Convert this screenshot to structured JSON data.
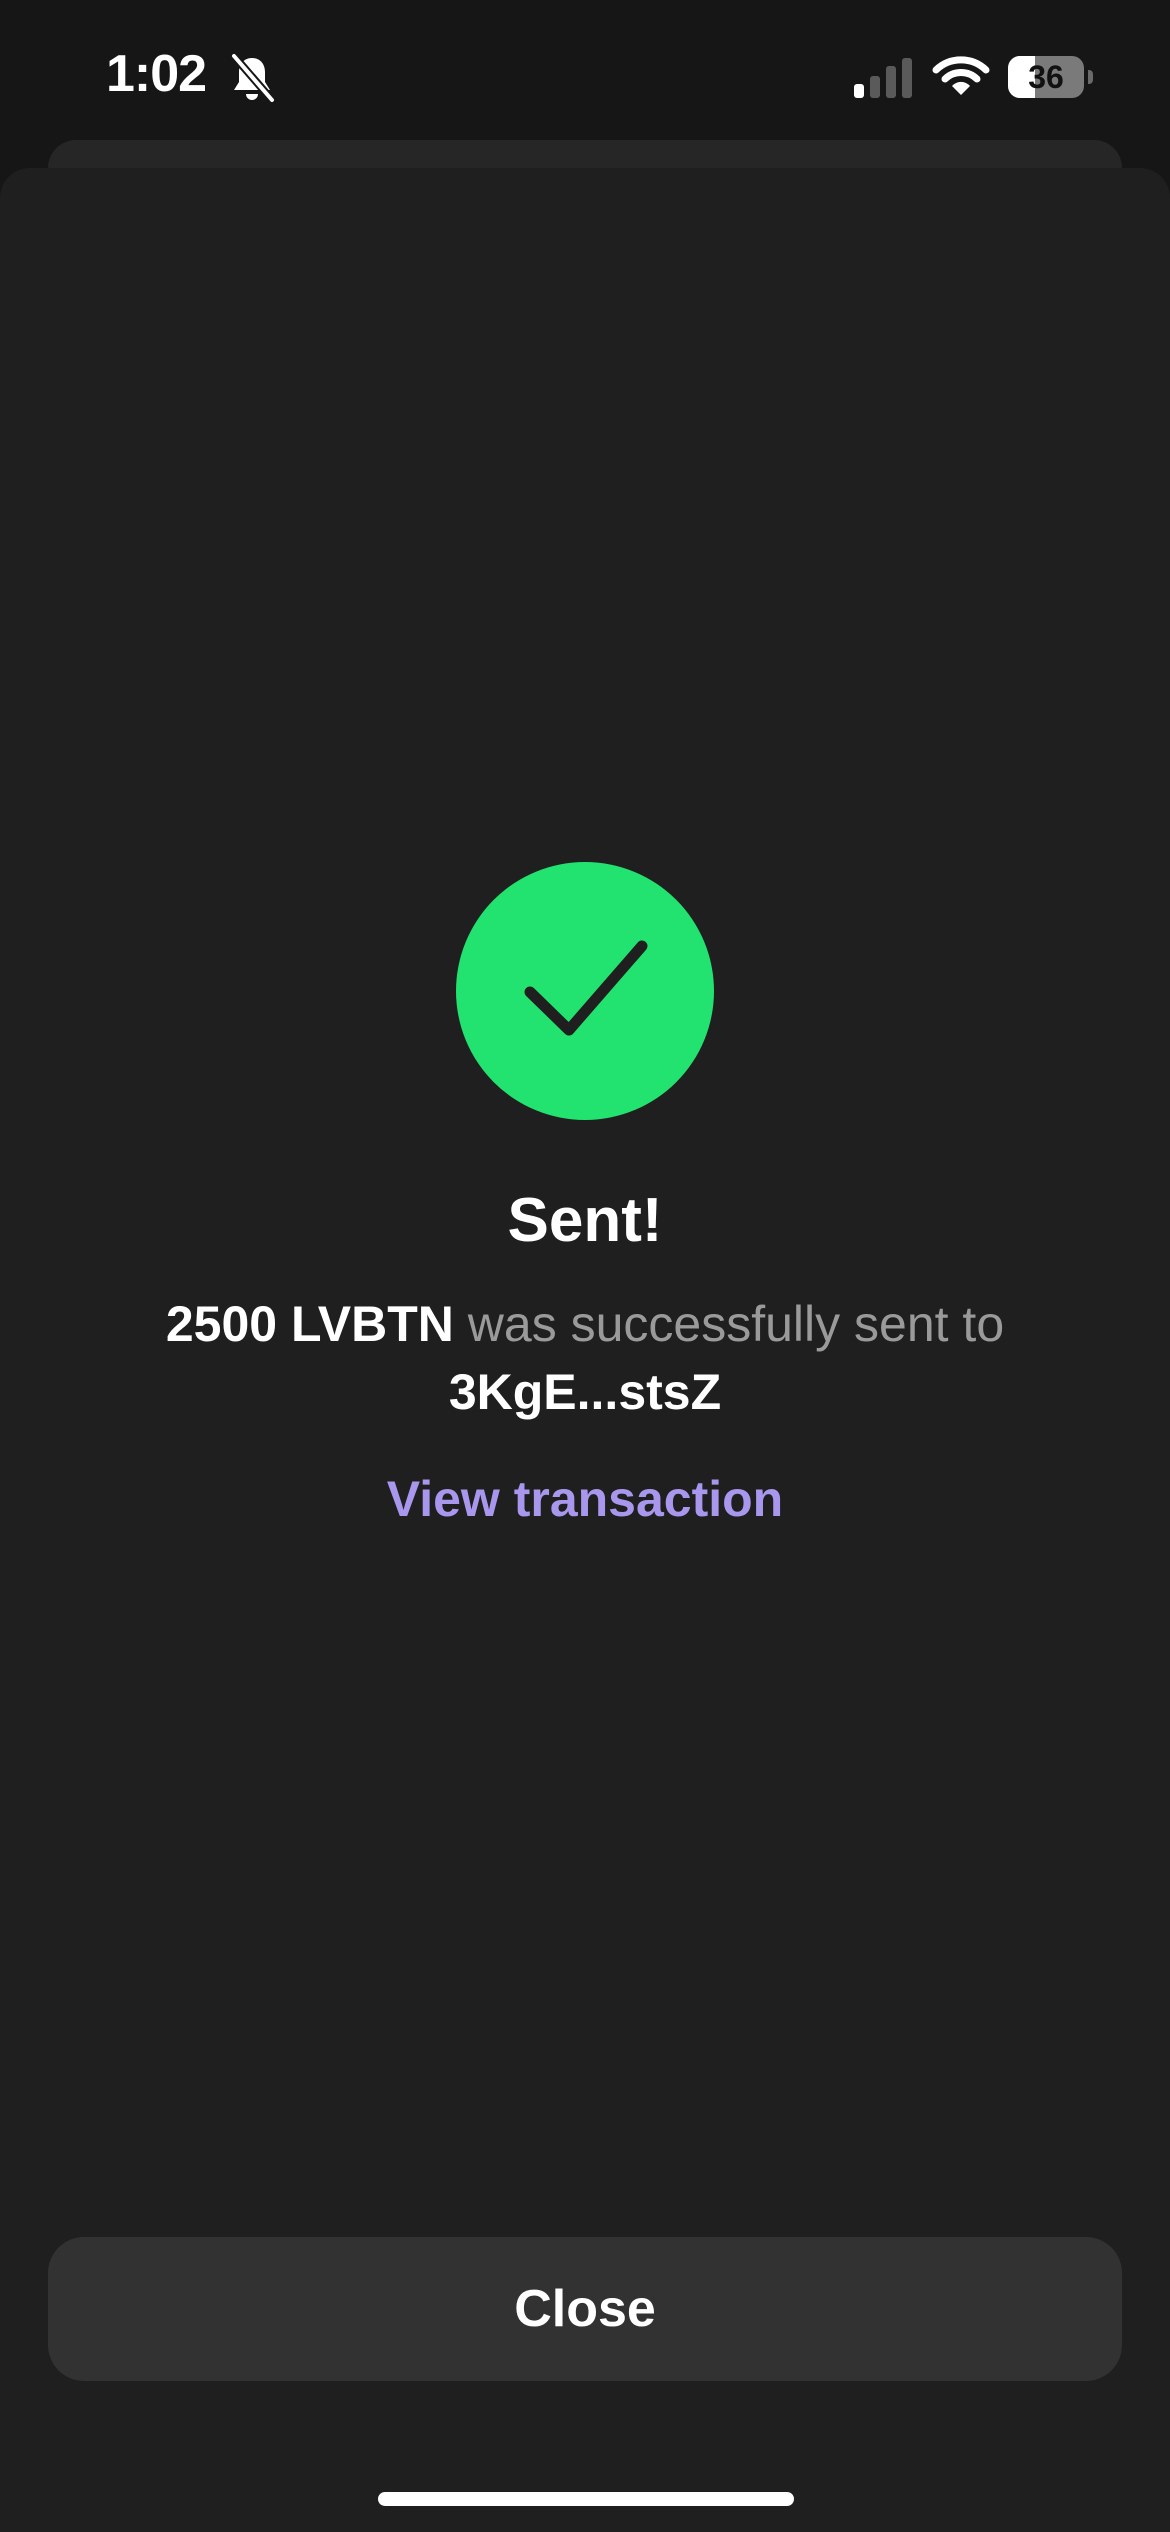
{
  "status_bar": {
    "time": "1:02",
    "battery_level": "36",
    "battery_fraction": 0.36,
    "icons": [
      "bell-slash-icon",
      "cellular-signal-icon",
      "wifi-icon",
      "battery-icon"
    ]
  },
  "success": {
    "icon": "checkmark-icon",
    "title": "Sent!",
    "amount": "2500 LVBTN",
    "message_middle": " was successfully sent to ",
    "recipient": "3KgE...stsZ",
    "view_link": "View transaction"
  },
  "footer": {
    "close_label": "Close"
  },
  "colors": {
    "background": "#1f1f1f",
    "success_green": "#22e36f",
    "link_purple": "#a897ec",
    "button": "#323232"
  }
}
